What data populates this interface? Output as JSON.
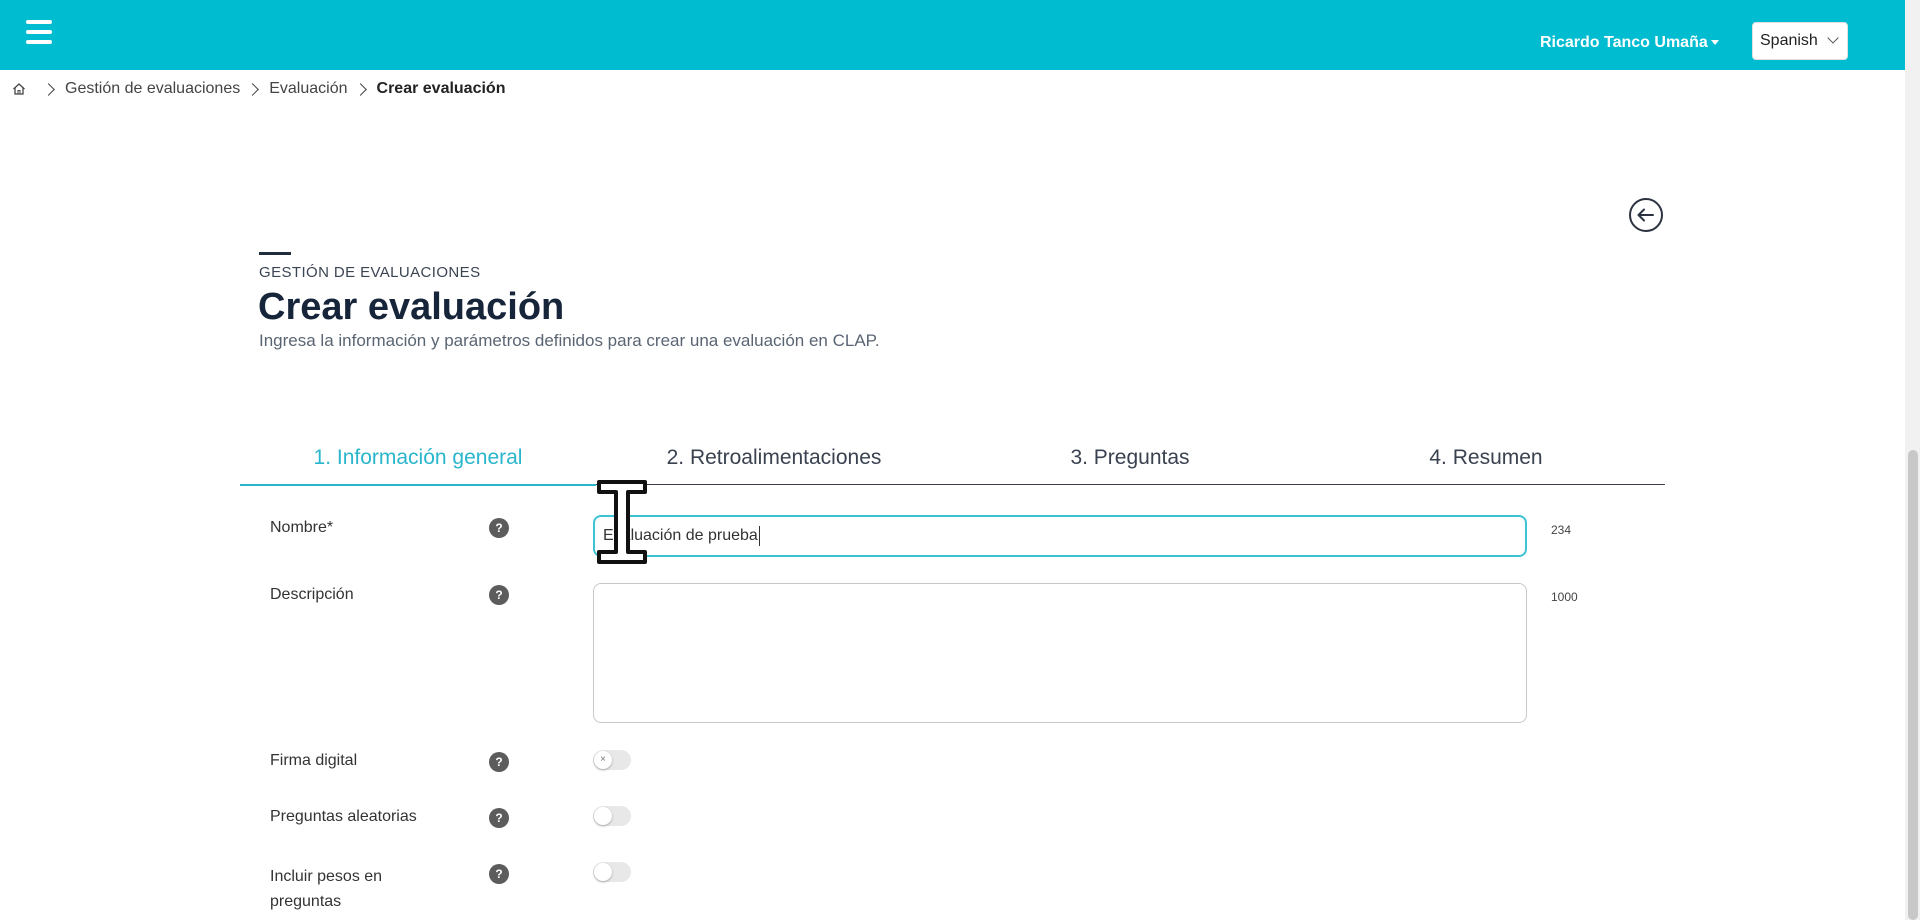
{
  "topbar": {
    "user_name": "Ricardo Tanco Umaña",
    "language": "Spanish",
    "bg_color": "#00bcd1"
  },
  "breadcrumb": {
    "items": [
      "Gestión de evaluaciones",
      "Evaluación"
    ],
    "current": "Crear evaluación"
  },
  "header": {
    "section_label": "GESTIÓN DE EVALUACIONES",
    "title": "Crear evaluación",
    "subtitle": "Ingresa la información y parámetros definidos para crear una evaluación en CLAP."
  },
  "tabs": [
    {
      "label": "1. Información general",
      "active": true
    },
    {
      "label": "2. Retroalimentaciones",
      "active": false
    },
    {
      "label": "3. Preguntas",
      "active": false
    },
    {
      "label": "4. Resumen",
      "active": false
    }
  ],
  "form": {
    "nombre": {
      "label": "Nombre*",
      "value": "Evaluación de prueba",
      "counter": "234"
    },
    "descripcion": {
      "label": "Descripción",
      "value": "",
      "counter": "1000"
    },
    "firma_digital": {
      "label": "Firma digital",
      "on": false
    },
    "preguntas_aleatorias": {
      "label": "Preguntas aleatorias",
      "on": false
    },
    "incluir_pesos": {
      "label": "Incluir pesos en preguntas",
      "on": false
    },
    "help_glyph": "?"
  },
  "colors": {
    "accent": "#29b6cc",
    "title": "#17253a"
  }
}
